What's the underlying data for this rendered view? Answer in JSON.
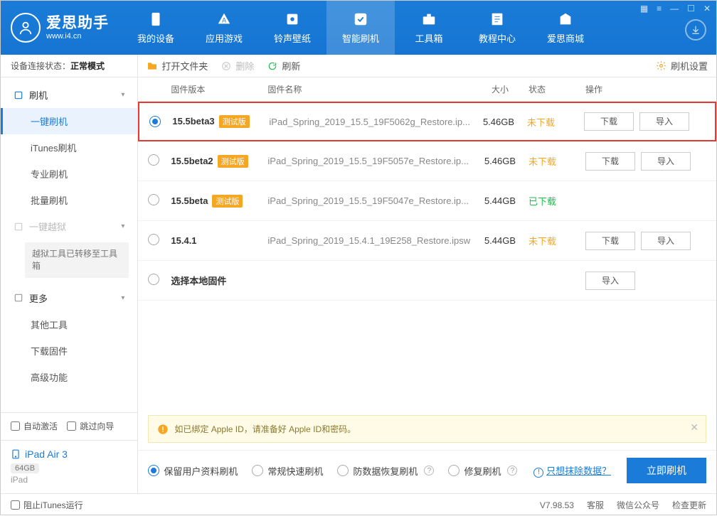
{
  "brand": {
    "name": "爱思助手",
    "url": "www.i4.cn"
  },
  "nav": [
    {
      "label": "我的设备"
    },
    {
      "label": "应用游戏"
    },
    {
      "label": "铃声壁纸"
    },
    {
      "label": "智能刷机",
      "active": true
    },
    {
      "label": "工具箱"
    },
    {
      "label": "教程中心"
    },
    {
      "label": "爱思商城"
    }
  ],
  "side_status": {
    "label": "设备连接状态：",
    "value": "正常模式"
  },
  "sidebar": {
    "flash_header": "刷机",
    "flash_items": [
      {
        "label": "一键刷机",
        "active": true
      },
      {
        "label": "iTunes刷机"
      },
      {
        "label": "专业刷机"
      },
      {
        "label": "批量刷机"
      }
    ],
    "jailbreak_header": "一键越狱",
    "jailbreak_note": "越狱工具已转移至工具箱",
    "more_header": "更多",
    "more_items": [
      {
        "label": "其他工具"
      },
      {
        "label": "下载固件"
      },
      {
        "label": "高级功能"
      }
    ]
  },
  "side_checks": {
    "auto_activate": "自动激活",
    "skip_guide": "跳过向导"
  },
  "device": {
    "name": "iPad Air 3",
    "capacity": "64GB",
    "type": "iPad"
  },
  "toolbar": {
    "open": "打开文件夹",
    "delete": "删除",
    "refresh": "刷新",
    "settings": "刷机设置"
  },
  "table": {
    "headers": {
      "version": "固件版本",
      "name": "固件名称",
      "size": "大小",
      "status": "状态",
      "ops": "操作"
    },
    "badge": "测试版",
    "ops": {
      "download": "下载",
      "import": "导入"
    },
    "status": {
      "und": "未下载",
      "dl": "已下载"
    },
    "rows": [
      {
        "selected": true,
        "version": "15.5beta3",
        "beta": true,
        "name": "iPad_Spring_2019_15.5_19F5062g_Restore.ip...",
        "size": "5.46GB",
        "status": "und",
        "download": true,
        "import": true,
        "highlight": true
      },
      {
        "selected": false,
        "version": "15.5beta2",
        "beta": true,
        "name": "iPad_Spring_2019_15.5_19F5057e_Restore.ip...",
        "size": "5.46GB",
        "status": "und",
        "download": true,
        "import": true
      },
      {
        "selected": false,
        "version": "15.5beta",
        "beta": true,
        "name": "iPad_Spring_2019_15.5_19F5047e_Restore.ip...",
        "size": "5.44GB",
        "status": "dl",
        "download": false,
        "import": false
      },
      {
        "selected": false,
        "version": "15.4.1",
        "beta": false,
        "name": "iPad_Spring_2019_15.4.1_19E258_Restore.ipsw",
        "size": "5.44GB",
        "status": "und",
        "download": true,
        "import": true
      },
      {
        "selected": false,
        "version": "选择本地固件",
        "beta": false,
        "name": "",
        "size": "",
        "status": "",
        "download": false,
        "import": true
      }
    ]
  },
  "notice": "如已绑定 Apple ID，请准备好 Apple ID和密码。",
  "flash_opts": [
    {
      "label": "保留用户资料刷机",
      "checked": true,
      "q": false
    },
    {
      "label": "常规快速刷机",
      "checked": false,
      "q": false
    },
    {
      "label": "防数据恢复刷机",
      "checked": false,
      "q": true
    },
    {
      "label": "修复刷机",
      "checked": false,
      "q": true
    }
  ],
  "erase_link": "只想抹除数据？",
  "flash_btn": "立即刷机",
  "footer": {
    "block_itunes": "阻止iTunes运行",
    "version": "V7.98.53",
    "svc": "客服",
    "wechat": "微信公众号",
    "update": "检查更新"
  }
}
